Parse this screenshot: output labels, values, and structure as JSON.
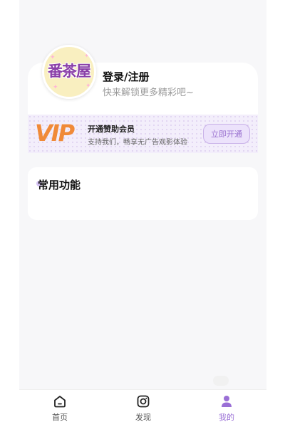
{
  "profile": {
    "avatar_logo_text": "番茶屋",
    "login_title": "登录/注册",
    "login_subtitle": "快来解锁更多精彩吧~"
  },
  "vip": {
    "logo_text": "VIP",
    "title": "开通赞助会员",
    "subtitle": "支持我们，畅享无广告观影体验",
    "button_label": "立即开通",
    "accent_color": "#f08a38"
  },
  "functions": {
    "title": "常用功能"
  },
  "bottom_nav": {
    "items": [
      {
        "label": "首页",
        "icon": "home-icon",
        "active": false
      },
      {
        "label": "发现",
        "icon": "instagram-icon",
        "active": false
      },
      {
        "label": "我的",
        "icon": "user-icon",
        "active": true
      }
    ],
    "active_color": "#9a6fd6"
  }
}
